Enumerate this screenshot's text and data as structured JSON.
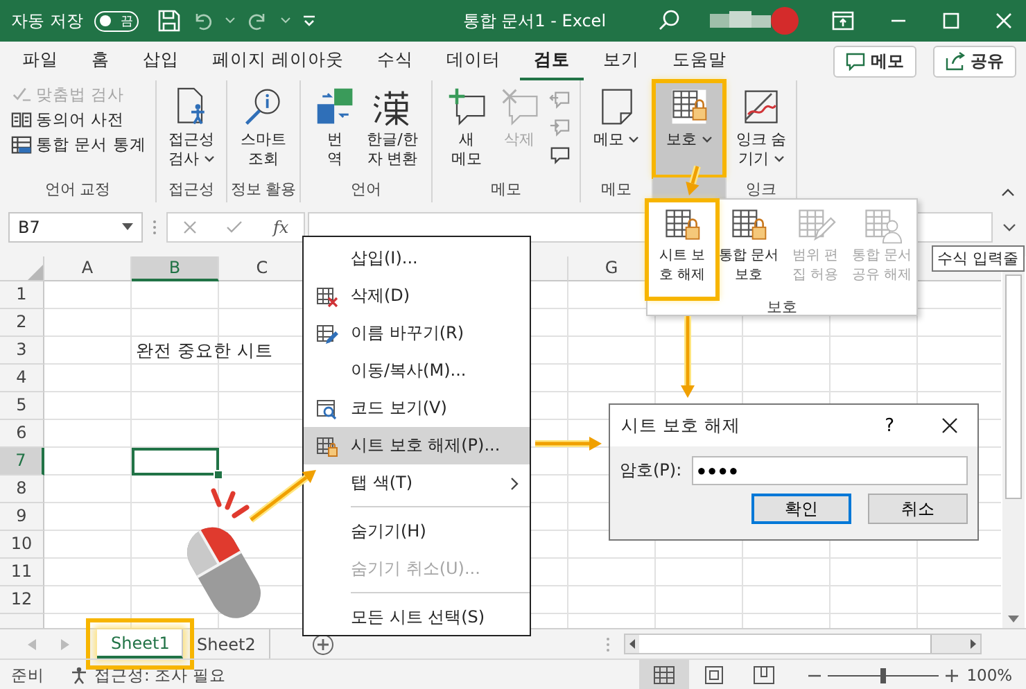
{
  "title_bar": {
    "autosave_label": "자동 저장",
    "autosave_toggle": {
      "on": false,
      "label": "끔"
    },
    "title": "통합 문서1  -  Excel"
  },
  "ribbon_tabs": [
    {
      "label": "파일",
      "selected": false
    },
    {
      "label": "홈",
      "selected": false
    },
    {
      "label": "삽입",
      "selected": false
    },
    {
      "label": "페이지 레이아웃",
      "selected": false
    },
    {
      "label": "수식",
      "selected": false
    },
    {
      "label": "데이터",
      "selected": false
    },
    {
      "label": "검토",
      "selected": true
    },
    {
      "label": "보기",
      "selected": false
    },
    {
      "label": "도움말",
      "selected": false
    }
  ],
  "ribbon_buttons": [
    {
      "label": "메모"
    },
    {
      "label": "공유"
    }
  ],
  "ribbon_groups": [
    {
      "label": "언어 교정",
      "commands": [
        {
          "kind": "small",
          "label": "맞춤법 검사",
          "disabled": true,
          "dropdown": false,
          "pressed": false,
          "callout": false
        },
        {
          "kind": "small",
          "label": "동의어 사전",
          "disabled": false,
          "dropdown": false,
          "pressed": false,
          "callout": false
        },
        {
          "kind": "small",
          "label": "통합 문서 통계",
          "disabled": false,
          "dropdown": false,
          "pressed": false,
          "callout": false
        }
      ]
    },
    {
      "label": "접근성",
      "commands": [
        {
          "kind": "large",
          "label": "접근성\n검사",
          "disabled": false,
          "dropdown": true,
          "pressed": false,
          "callout": false
        }
      ]
    },
    {
      "label": "정보 활용",
      "commands": [
        {
          "kind": "large",
          "label": "스마트\n조회",
          "disabled": false,
          "dropdown": false,
          "pressed": false,
          "callout": false
        }
      ]
    },
    {
      "label": "언어",
      "commands": [
        {
          "kind": "large",
          "label": "번\n역",
          "disabled": false,
          "dropdown": false,
          "pressed": false,
          "callout": false
        },
        {
          "kind": "large",
          "label": "한글/한\n자 변환",
          "disabled": false,
          "dropdown": false,
          "pressed": false,
          "callout": false
        }
      ]
    },
    {
      "label": "메모",
      "commands": [
        {
          "kind": "large",
          "label": "새\n메모",
          "disabled": false,
          "dropdown": false,
          "pressed": false,
          "callout": false
        },
        {
          "kind": "large",
          "label": "삭제",
          "disabled": true,
          "dropdown": false,
          "pressed": false,
          "callout": false
        },
        {
          "kind": "mini",
          "disabled": true
        },
        {
          "kind": "mini",
          "disabled": true
        },
        {
          "kind": "mini",
          "disabled": false
        }
      ]
    },
    {
      "label": "메모",
      "commands": [
        {
          "kind": "large",
          "label": "메모",
          "disabled": false,
          "dropdown": true,
          "pressed": false,
          "callout": false
        }
      ]
    },
    {
      "commands": [
        {
          "kind": "large",
          "label": "보호",
          "disabled": false,
          "dropdown": true,
          "pressed": true,
          "callout": true
        }
      ]
    },
    {
      "label": "잉크",
      "commands": [
        {
          "kind": "large",
          "label": "잉크 숨\n기기",
          "disabled": false,
          "dropdown": true,
          "pressed": false,
          "callout": false
        }
      ]
    }
  ],
  "protect_menu": {
    "label": "보호",
    "items": [
      {
        "label": "시트 보\n호 해제",
        "disabled": false,
        "callout": true
      },
      {
        "label": "통합 문서\n보호",
        "disabled": false,
        "callout": false
      },
      {
        "label": "범위 편\n집 허용",
        "disabled": true,
        "callout": false
      },
      {
        "label": "통합 문서\n공유 해제",
        "disabled": true,
        "callout": false
      }
    ]
  },
  "formula_bar": {
    "name_box": "B7",
    "function_label": "fx",
    "tooltip": "수식 입력줄"
  },
  "sheet": {
    "columns": [
      {
        "label": "A",
        "selected": false
      },
      {
        "label": "B",
        "selected": true
      },
      {
        "label": "C",
        "selected": false
      },
      {},
      {},
      {
        "selected": false
      },
      {
        "label": "G",
        "selected": false
      },
      {},
      {},
      {},
      {
        "selected": false
      }
    ],
    "rows": [
      {
        "header": "1",
        "selected": false
      },
      {
        "header": "2",
        "selected": false
      },
      {
        "header": "3",
        "selected": false,
        "cells": [
          null,
          {
            "text": "완전 중요한 시트",
            "selected": false
          }
        ]
      },
      {
        "header": "4",
        "selected": false
      },
      {
        "header": "5",
        "selected": false
      },
      {
        "header": "6",
        "selected": false
      },
      {
        "header": "7",
        "selected": true,
        "cells": [
          null,
          {
            "selected": true
          }
        ]
      },
      {
        "header": "8",
        "selected": false
      },
      {
        "header": "9",
        "selected": false
      },
      {
        "header": "10",
        "selected": false
      },
      {
        "header": "11",
        "selected": false
      },
      {
        "header": "12",
        "selected": false
      },
      {
        "selected": false
      }
    ]
  },
  "context_menu": {
    "items": [
      {
        "kind": "item",
        "label": "삽입(I)...",
        "disabled": false,
        "selected": false,
        "submenu": false
      },
      {
        "kind": "item",
        "label": "삭제(D)",
        "disabled": false,
        "selected": false,
        "submenu": false
      },
      {
        "kind": "item",
        "label": "이름 바꾸기(R)",
        "disabled": false,
        "selected": false,
        "submenu": false
      },
      {
        "kind": "item",
        "label": "이동/복사(M)...",
        "disabled": false,
        "selected": false,
        "submenu": false
      },
      {
        "kind": "item",
        "label": "코드 보기(V)",
        "disabled": false,
        "selected": false,
        "submenu": false
      },
      {
        "kind": "item",
        "label": "시트 보호 해제(P)...",
        "disabled": false,
        "selected": true,
        "submenu": false
      },
      {
        "kind": "item",
        "label": "탭 색(T)",
        "disabled": false,
        "selected": false,
        "submenu": true
      },
      {
        "kind": "separator"
      },
      {
        "kind": "item",
        "label": "숨기기(H)",
        "disabled": false,
        "selected": false,
        "submenu": false
      },
      {
        "kind": "item",
        "label": "숨기기 취소(U)...",
        "disabled": true,
        "selected": false,
        "submenu": false
      },
      {
        "kind": "separator"
      },
      {
        "kind": "item",
        "label": "모든 시트 선택(S)",
        "disabled": false,
        "selected": false,
        "submenu": false
      }
    ]
  },
  "dialog": {
    "title": "시트 보호 해제",
    "help": "?",
    "field_label": "암호(P):",
    "password": "●●●●",
    "buttons": [
      {
        "label": "확인",
        "default": true
      },
      {
        "label": "취소",
        "default": false
      }
    ]
  },
  "sheet_tabs": [
    {
      "label": "Sheet1",
      "selected": true,
      "callout": true
    },
    {
      "label": "Sheet2",
      "selected": false,
      "callout": false
    }
  ],
  "status_bar": {
    "status": "준비",
    "accessibility": "접근성: 조사 필요",
    "views": [
      {
        "selected": true
      },
      {
        "selected": false
      },
      {
        "selected": false
      }
    ],
    "zoom": {
      "level": 0.5,
      "reading": "100%"
    }
  }
}
